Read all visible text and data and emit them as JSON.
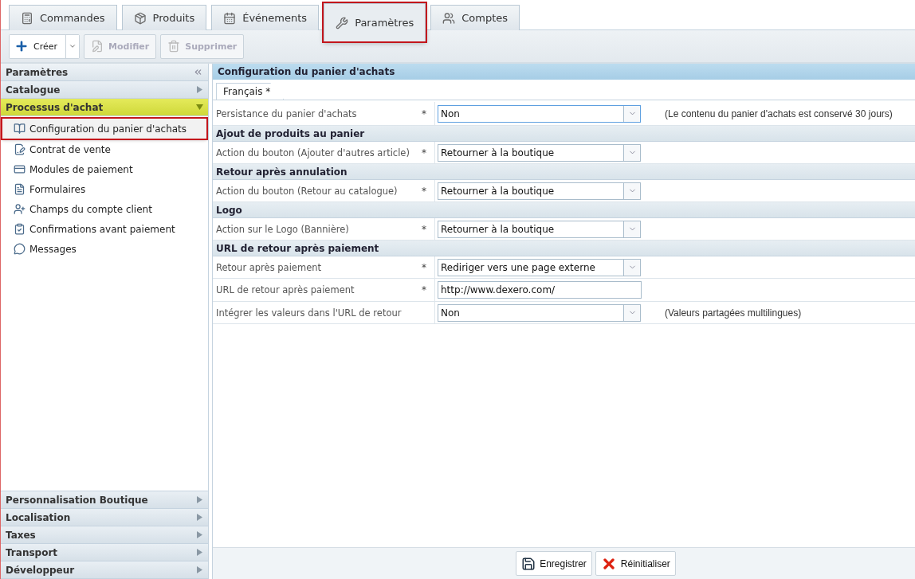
{
  "tabs": [
    {
      "label": "Commandes",
      "selected": false
    },
    {
      "label": "Produits",
      "selected": false
    },
    {
      "label": "Événements",
      "selected": false
    },
    {
      "label": "Paramètres",
      "selected": true
    },
    {
      "label": "Comptes",
      "selected": false
    }
  ],
  "toolbar": [
    {
      "kind": "split",
      "label": "Créer",
      "disabled": false
    },
    {
      "kind": "edit",
      "label": "Modifier",
      "disabled": true
    },
    {
      "kind": "delete",
      "label": "Supprimer",
      "disabled": true
    }
  ],
  "sidebar": {
    "title": "Paramètres",
    "sections": [
      {
        "label": "Catalogue",
        "expanded": false
      },
      {
        "label": "Processus d'achat",
        "expanded": true,
        "items": [
          {
            "label": "Configuration du panier d'achats",
            "selected": true
          },
          {
            "label": "Contrat de vente",
            "selected": false
          },
          {
            "label": "Modules de paiement",
            "selected": false
          },
          {
            "label": "Formulaires",
            "selected": false
          },
          {
            "label": "Champs du compte client",
            "selected": false
          },
          {
            "label": "Confirmations avant paiement",
            "selected": false
          },
          {
            "label": "Messages",
            "selected": false
          }
        ]
      },
      {
        "label": "Personnalisation Boutique",
        "expanded": false
      },
      {
        "label": "Localisation",
        "expanded": false
      },
      {
        "label": "Taxes",
        "expanded": false
      },
      {
        "label": "Transport",
        "expanded": false
      },
      {
        "label": "Développeur",
        "expanded": false
      }
    ]
  },
  "form": {
    "title": "Configuration du panier d'achats",
    "language_tabs": [
      {
        "label": "Français *",
        "selected": true
      }
    ],
    "rows": [
      {
        "kind": "select",
        "label": "Persistance du panier d'achats",
        "required_mark": "*",
        "value": "Non",
        "focused": true,
        "note": "(Le contenu du panier d'achats est conservé 30 jours)"
      },
      {
        "kind": "header",
        "label": "Ajout de produits au panier"
      },
      {
        "kind": "select",
        "label": "Action du bouton (Ajouter d'autres article)",
        "required_mark": "*",
        "value": "Retourner à la boutique",
        "focused": false
      },
      {
        "kind": "header",
        "label": "Retour après annulation"
      },
      {
        "kind": "select",
        "label": "Action du bouton (Retour au catalogue)",
        "required_mark": "*",
        "value": "Retourner à la boutique",
        "focused": false
      },
      {
        "kind": "header",
        "label": "Logo"
      },
      {
        "kind": "select",
        "label": "Action sur le Logo (Bannière)",
        "required_mark": "*",
        "value": "Retourner à la boutique",
        "focused": false
      },
      {
        "kind": "header",
        "label": "URL de retour après paiement"
      },
      {
        "kind": "select",
        "label": "Retour après paiement",
        "required_mark": "*",
        "value": "Rediriger vers une page externe",
        "focused": false
      },
      {
        "kind": "text",
        "label": "URL de retour après paiement",
        "required_mark": "*",
        "value": "http://www.dexero.com/",
        "focused": false
      },
      {
        "kind": "select",
        "label": "Intégrer les valeurs dans l'URL de retour",
        "value": "Non",
        "focused": false,
        "note": "(Valeurs partagées multilingues)"
      }
    ]
  },
  "footer": [
    {
      "kind": "save",
      "label": "Enregistrer"
    },
    {
      "kind": "reset",
      "label": "Réinitialiser"
    }
  ]
}
